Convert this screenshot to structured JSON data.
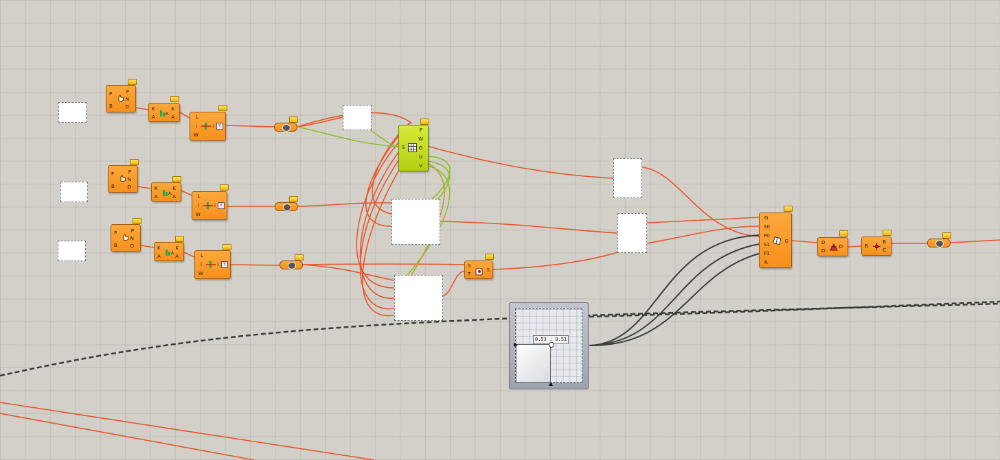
{
  "rows": [
    {
      "pointcomp": {
        "in": [
          "P",
          "B"
        ],
        "out": [
          "P",
          "N",
          "D"
        ]
      },
      "kcomp": {
        "in": [
          "K",
          "A"
        ],
        "out": [
          "K",
          "A"
        ]
      },
      "listcomp": {
        "in": [
          "L",
          "i",
          "W"
        ],
        "out": [
          "i"
        ],
        "tag": "Y"
      }
    },
    {
      "pointcomp": {
        "in": [
          "P",
          "B"
        ],
        "out": [
          "P",
          "N",
          "D"
        ]
      },
      "kcomp": {
        "in": [
          "K",
          "A"
        ],
        "out": [
          "K",
          "A"
        ]
      },
      "listcomp": {
        "in": [
          "L",
          "i",
          "W"
        ],
        "out": [
          "i"
        ],
        "tag": "Y"
      }
    },
    {
      "pointcomp": {
        "in": [
          "P",
          "B"
        ],
        "out": [
          "P",
          "N",
          "D"
        ]
      },
      "kcomp": {
        "in": [
          "K",
          "A"
        ],
        "out": [
          "K",
          "A"
        ]
      },
      "listcomp": {
        "in": [
          "L",
          "i",
          "W"
        ],
        "out": [
          "i"
        ],
        "tag": "Y"
      }
    }
  ],
  "surface_grid": {
    "in": [
      "S"
    ],
    "out": [
      "P",
      "W",
      "G",
      "U",
      "V"
    ],
    "color": "#c2d91c"
  },
  "sampler": {
    "in": [
      "S",
      "T"
    ],
    "out": [
      "S"
    ]
  },
  "graph_mapper": {
    "in": [
      "G",
      "S0",
      "P0",
      "S1",
      "P1",
      "R"
    ],
    "out": [
      "G"
    ]
  },
  "d_comp": {
    "in": [
      "D",
      "O"
    ],
    "out": [
      "D"
    ]
  },
  "b_comp": {
    "in": [
      "B"
    ],
    "out": [
      "B",
      "C"
    ]
  },
  "md_slider": {
    "readout": "0.53 ; 0.51",
    "value": [
      0.53,
      0.51
    ]
  },
  "colors": {
    "wire_orange": "#e8562a",
    "wire_green": "#8bbf2a",
    "wire_dark": "#3d3d3d",
    "canvas": "#d3d0c9"
  }
}
